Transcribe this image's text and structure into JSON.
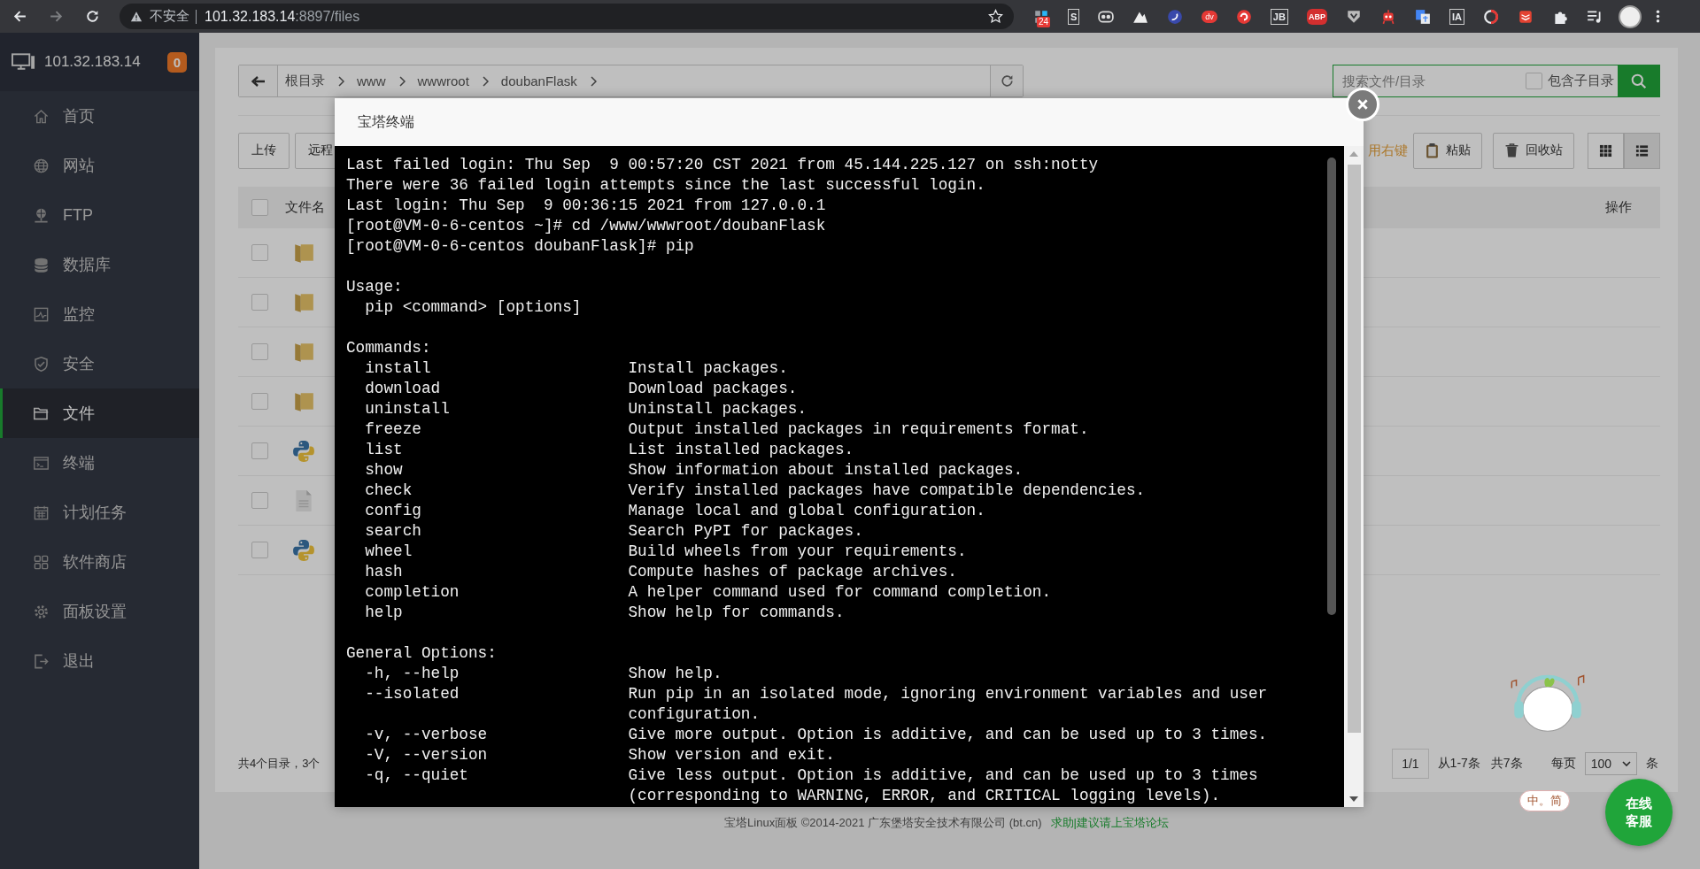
{
  "browser": {
    "security": "不安全",
    "host": "101.32.183.14",
    "path": ":8897/files",
    "extensions": [
      {
        "kind": "grid",
        "badge": "24"
      },
      {
        "kind": "letter",
        "text": "S"
      },
      {
        "kind": "owl"
      },
      {
        "kind": "mountain"
      },
      {
        "kind": "swirl"
      },
      {
        "kind": "pill",
        "text": "dv"
      },
      {
        "kind": "arrow"
      },
      {
        "kind": "letter",
        "text": "JB"
      },
      {
        "kind": "octagon",
        "text": "ABP"
      },
      {
        "kind": "shield"
      },
      {
        "kind": "robot"
      },
      {
        "kind": "translate"
      },
      {
        "kind": "letter",
        "text": "IA"
      },
      {
        "kind": "ring"
      },
      {
        "kind": "stack"
      },
      {
        "kind": "puzzle"
      },
      {
        "kind": "playlist"
      }
    ]
  },
  "sidebar": {
    "host": "101.32.183.14",
    "badge": "0",
    "items": [
      {
        "label": "首页",
        "selected": false
      },
      {
        "label": "网站",
        "selected": false
      },
      {
        "label": "FTP",
        "selected": false
      },
      {
        "label": "数据库",
        "selected": false
      },
      {
        "label": "监控",
        "selected": false
      },
      {
        "label": "安全",
        "selected": false
      },
      {
        "label": "文件",
        "selected": true
      },
      {
        "label": "终端",
        "selected": false
      },
      {
        "label": "计划任务",
        "selected": false
      },
      {
        "label": "软件商店",
        "selected": false
      },
      {
        "label": "面板设置",
        "selected": false
      },
      {
        "label": "退出",
        "selected": false
      }
    ]
  },
  "breadcrumb": [
    "根目录",
    "www",
    "wwwroot",
    "doubanFlask"
  ],
  "search": {
    "placeholder": "搜索文件/目录",
    "include_sub": {
      "label": "包含子目录",
      "checked": false
    }
  },
  "toolbar": {
    "buttons": [
      "上传",
      "远程"
    ],
    "hint": "用右键",
    "actions": [
      "粘贴",
      "回收站"
    ],
    "views": [
      {
        "selected": false
      },
      {
        "selected": true
      }
    ]
  },
  "table": {
    "columns": [
      "文件名",
      "操作"
    ],
    "select_all": {
      "checked": false
    },
    "rows": [
      {
        "kind": "folder",
        "checked": false
      },
      {
        "kind": "folder",
        "checked": false
      },
      {
        "kind": "folder",
        "checked": false
      },
      {
        "kind": "folder",
        "checked": false
      },
      {
        "kind": "python",
        "checked": false
      },
      {
        "kind": "text",
        "checked": false
      },
      {
        "kind": "python",
        "checked": false
      }
    ]
  },
  "summary": "共4个目录，3个",
  "pagination": {
    "page": "1/1",
    "range": "从1-7条",
    "total": "共7条",
    "per_page_label": "每页",
    "per_page": "100",
    "unit": "条"
  },
  "footer": {
    "text": "宝塔Linux面板 ©2014-2021 广东堡塔安全技术有限公司 (bt.cn)",
    "link": "求助|建议请上宝塔论坛"
  },
  "modal": {
    "title": "宝塔终端",
    "blocks": [
      [
        {
          "kind": "line",
          "text": "Last failed login: Thu Sep  9 00:57:20 CST 2021 from 45.144.225.127 on ssh:notty"
        },
        {
          "kind": "line",
          "text": "There were 36 failed login attempts since the last successful login."
        },
        {
          "kind": "line",
          "text": "Last login: Thu Sep  9 00:36:15 2021 from 127.0.0.1"
        },
        {
          "kind": "line",
          "text": "[root@VM-0-6-centos ~]# cd /www/wwwroot/doubanFlask"
        },
        {
          "kind": "line",
          "text": "[root@VM-0-6-centos doubanFlask]# pip"
        }
      ],
      [
        {
          "kind": "line",
          "text": "Usage:"
        },
        {
          "kind": "line",
          "text": "  pip <command> [options]"
        }
      ],
      [
        {
          "kind": "line",
          "text": "Commands:"
        },
        {
          "kind": "option",
          "name": "install",
          "desc": "Install packages."
        },
        {
          "kind": "option",
          "name": "download",
          "desc": "Download packages."
        },
        {
          "kind": "option",
          "name": "uninstall",
          "desc": "Uninstall packages."
        },
        {
          "kind": "option",
          "name": "freeze",
          "desc": "Output installed packages in requirements format."
        },
        {
          "kind": "option",
          "name": "list",
          "desc": "List installed packages."
        },
        {
          "kind": "option",
          "name": "show",
          "desc": "Show information about installed packages."
        },
        {
          "kind": "option",
          "name": "check",
          "desc": "Verify installed packages have compatible dependencies."
        },
        {
          "kind": "option",
          "name": "config",
          "desc": "Manage local and global configuration."
        },
        {
          "kind": "option",
          "name": "search",
          "desc": "Search PyPI for packages."
        },
        {
          "kind": "option",
          "name": "wheel",
          "desc": "Build wheels from your requirements."
        },
        {
          "kind": "option",
          "name": "hash",
          "desc": "Compute hashes of package archives."
        },
        {
          "kind": "option",
          "name": "completion",
          "desc": "A helper command used for command completion."
        },
        {
          "kind": "option",
          "name": "help",
          "desc": "Show help for commands."
        }
      ],
      [
        {
          "kind": "line",
          "text": "General Options:"
        },
        {
          "kind": "option",
          "name": "-h, --help",
          "desc": "Show help."
        },
        {
          "kind": "option",
          "name": "--isolated",
          "desc": "Run pip in an isolated mode, ignoring environment variables and user configuration."
        },
        {
          "kind": "option",
          "name": "-v, --verbose",
          "desc": "Give more output. Option is additive, and can be used up to 3 times."
        },
        {
          "kind": "option",
          "name": "-V, --version",
          "desc": "Show version and exit."
        },
        {
          "kind": "option",
          "name": "-q, --quiet",
          "desc": "Give less output. Option is additive, and can be used up to 3 times (corresponding to WARNING, ERROR, and CRITICAL logging levels)."
        }
      ]
    ]
  },
  "ime": "中。简",
  "chat_button": "在线客服"
}
